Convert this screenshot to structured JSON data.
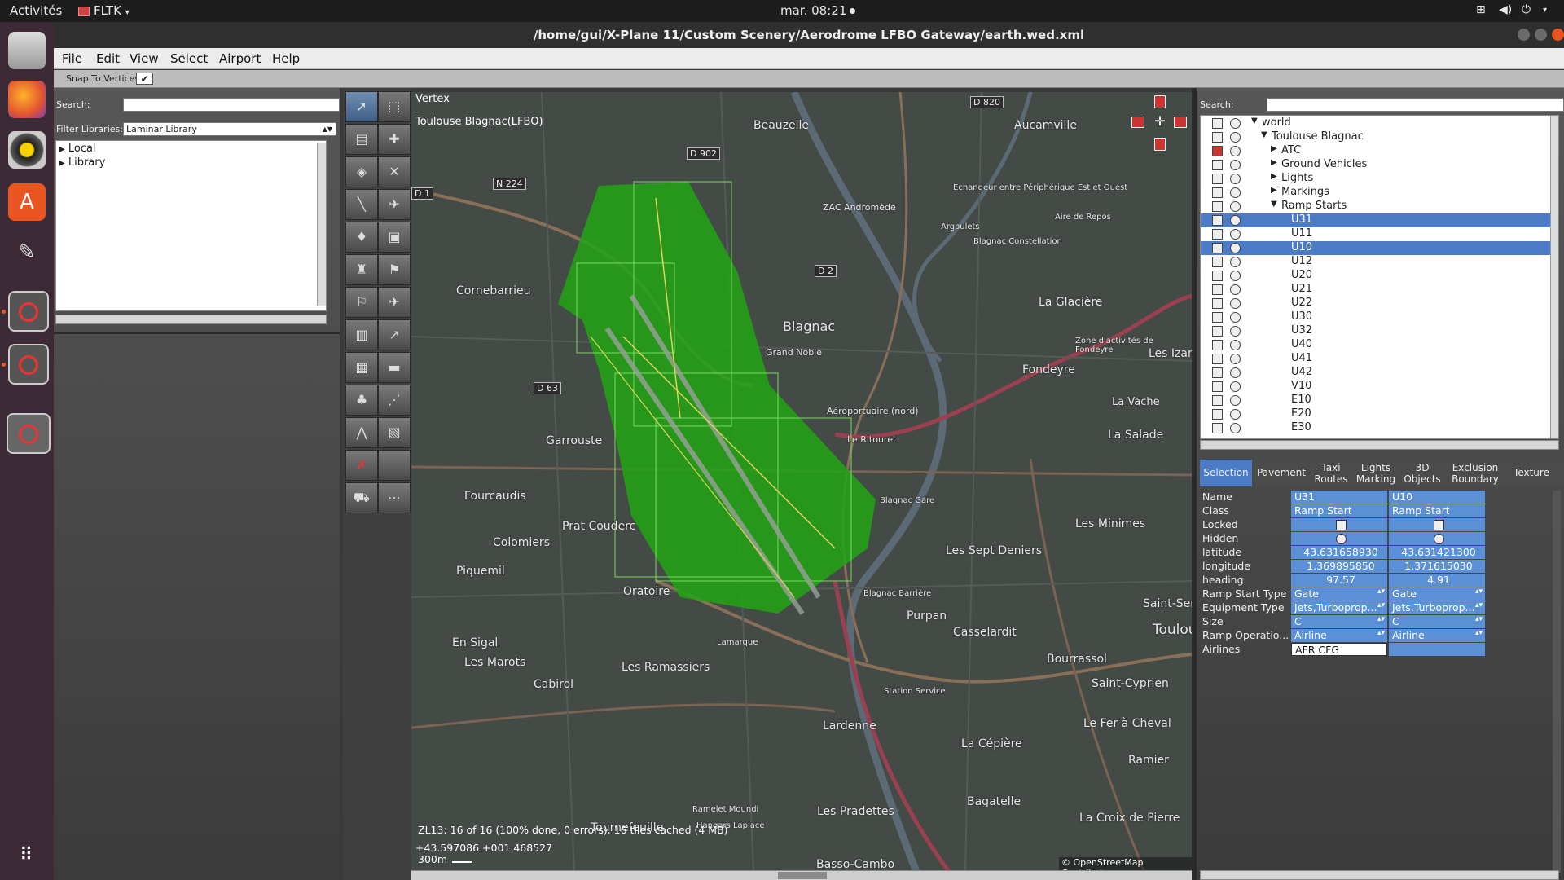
{
  "topbar": {
    "activities": "Activités",
    "app": "FLTK",
    "clock": "mar. 08:21"
  },
  "window": {
    "title": "/home/gui/X-Plane 11/Custom Scenery/Aerodrome LFBO Gateway/earth.wed.xml"
  },
  "menu": [
    "File",
    "Edit",
    "View",
    "Select",
    "Airport",
    "Help"
  ],
  "snap": {
    "label": "Snap To Vertices",
    "checked": true
  },
  "left": {
    "search_label": "Search:",
    "filter_label": "Filter Libraries:",
    "filter_value": "Laminar Library",
    "items": [
      "Local",
      "Library"
    ]
  },
  "map": {
    "tool": "Vertex",
    "airport": "Toulouse Blagnac(LFBO)",
    "status": "ZL13: 16 of 16 (100% done, 0 errors). 16 tiles cached (4 MB)",
    "coords": "+43.597086 +001.468527",
    "scale": "300m",
    "attribution": "© OpenStreetMap Contributors",
    "places": [
      "Beauzelle",
      "Aucamville",
      "Cornebarrieu",
      "Blagnac",
      "Grand Noble",
      "Fondeyre",
      "Les Izards",
      "La Vache",
      "La Salade",
      "Garrouste",
      "Fourcaudis",
      "Prat Couderc",
      "Les Sept Deniers",
      "Les Minimes",
      "Colomiers",
      "Piquemil",
      "Oratoire",
      "Purpan",
      "Casselardit",
      "En Sigal",
      "Les Marots",
      "Les Ramassiers",
      "Cabirol",
      "Bourrassol",
      "Saint-Cyprien",
      "Lardenne",
      "La Cépière",
      "Ramier",
      "Tournefeuille",
      "Les Pradettes",
      "Bagatelle",
      "La Croix de Pierre",
      "Le Fer à Cheval",
      "Basso-Cambo",
      "La Glacière",
      "Saint-Sern",
      "Toulou",
      "ZAC Andromède",
      "Aéroportuaire (nord)",
      "Le Ritouret",
      "Zone d'activités de Fondeyre",
      "Aire de Repos",
      "Échangeur entre Périphérique Est et Ouest",
      "Blagnac Constellation",
      "Blagnac Gare",
      "Blagnac Barrière",
      "Station Service",
      "Lamarque",
      "Ramelet Moundi",
      "Hangars Laplace",
      "Argoulets"
    ],
    "roads": [
      "D 820",
      "N 224",
      "D 1",
      "D 2",
      "D 63",
      "D 902"
    ]
  },
  "right": {
    "search_label": "Search:",
    "tree": [
      {
        "label": "world",
        "indent": 0,
        "expanded": true,
        "selected": false,
        "locked": false
      },
      {
        "label": "Toulouse Blagnac",
        "indent": 1,
        "expanded": true,
        "selected": false,
        "locked": false
      },
      {
        "label": "ATC",
        "indent": 2,
        "expanded": false,
        "selected": false,
        "locked": true
      },
      {
        "label": "Ground Vehicles",
        "indent": 2,
        "expanded": false,
        "selected": false,
        "locked": false
      },
      {
        "label": "Lights",
        "indent": 2,
        "expanded": false,
        "selected": false,
        "locked": false
      },
      {
        "label": "Markings",
        "indent": 2,
        "expanded": false,
        "selected": false,
        "locked": false
      },
      {
        "label": "Ramp Starts",
        "indent": 2,
        "expanded": true,
        "selected": false,
        "locked": false
      },
      {
        "label": "U31",
        "indent": 3,
        "selected": true,
        "locked": false
      },
      {
        "label": "U11",
        "indent": 3,
        "selected": false,
        "locked": false
      },
      {
        "label": "U10",
        "indent": 3,
        "selected": true,
        "locked": false
      },
      {
        "label": "U12",
        "indent": 3,
        "selected": false,
        "locked": false
      },
      {
        "label": "U20",
        "indent": 3,
        "selected": false,
        "locked": false
      },
      {
        "label": "U21",
        "indent": 3,
        "selected": false,
        "locked": false
      },
      {
        "label": "U22",
        "indent": 3,
        "selected": false,
        "locked": false
      },
      {
        "label": "U30",
        "indent": 3,
        "selected": false,
        "locked": false
      },
      {
        "label": "U32",
        "indent": 3,
        "selected": false,
        "locked": false
      },
      {
        "label": "U40",
        "indent": 3,
        "selected": false,
        "locked": false
      },
      {
        "label": "U41",
        "indent": 3,
        "selected": false,
        "locked": false
      },
      {
        "label": "U42",
        "indent": 3,
        "selected": false,
        "locked": false
      },
      {
        "label": "V10",
        "indent": 3,
        "selected": false,
        "locked": false
      },
      {
        "label": "E10",
        "indent": 3,
        "selected": false,
        "locked": false
      },
      {
        "label": "E20",
        "indent": 3,
        "selected": false,
        "locked": false
      },
      {
        "label": "E30",
        "indent": 3,
        "selected": false,
        "locked": false
      }
    ],
    "tabs": [
      "Selection",
      "Pavement",
      "Taxi Routes",
      "Lights Marking",
      "3D Objects",
      "Exclusion Boundary",
      "Texture"
    ],
    "props": [
      {
        "key": "Name",
        "v1": "U31",
        "v2": "U10",
        "kind": "text"
      },
      {
        "key": "Class",
        "v1": "Ramp Start",
        "v2": "Ramp Start",
        "kind": "text"
      },
      {
        "key": "Locked",
        "v1": "",
        "v2": "",
        "kind": "check"
      },
      {
        "key": "Hidden",
        "v1": "",
        "v2": "",
        "kind": "eye"
      },
      {
        "key": "latitude",
        "v1": "43.631658930",
        "v2": "43.631421300",
        "kind": "num"
      },
      {
        "key": "longitude",
        "v1": "1.369895850",
        "v2": "1.371615030",
        "kind": "num"
      },
      {
        "key": "heading",
        "v1": "97.57",
        "v2": "4.91",
        "kind": "num"
      },
      {
        "key": "Ramp Start Type",
        "v1": "Gate",
        "v2": "Gate",
        "kind": "select"
      },
      {
        "key": "Equipment Type",
        "v1": "Jets,Turboprop...",
        "v2": "Jets,Turboprop...",
        "kind": "select"
      },
      {
        "key": "Size",
        "v1": "C",
        "v2": "C",
        "kind": "select"
      },
      {
        "key": "Ramp Operatio...",
        "v1": "Airline",
        "v2": "Airline",
        "kind": "select"
      },
      {
        "key": "Airlines",
        "v1": "AFR CFG",
        "v2": "",
        "kind": "edit"
      }
    ]
  }
}
